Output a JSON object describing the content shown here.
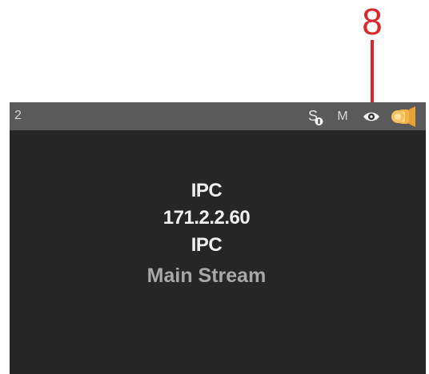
{
  "callout": {
    "number": "8",
    "color": "#d8262b"
  },
  "channel": {
    "number": "2",
    "header_color": "#5a5a5a",
    "background_color": "#262626"
  },
  "status_icons": [
    {
      "name": "sound-icon",
      "glyph": "S"
    },
    {
      "name": "motion-icon",
      "text": "M"
    },
    {
      "name": "eye-icon"
    },
    {
      "name": "flashlight-icon",
      "color": "#f1b04a"
    }
  ],
  "stream": {
    "device_type": "IPC",
    "ip_address": "171.2.2.60",
    "protocol": "IPC",
    "stream_type": "Main Stream"
  }
}
